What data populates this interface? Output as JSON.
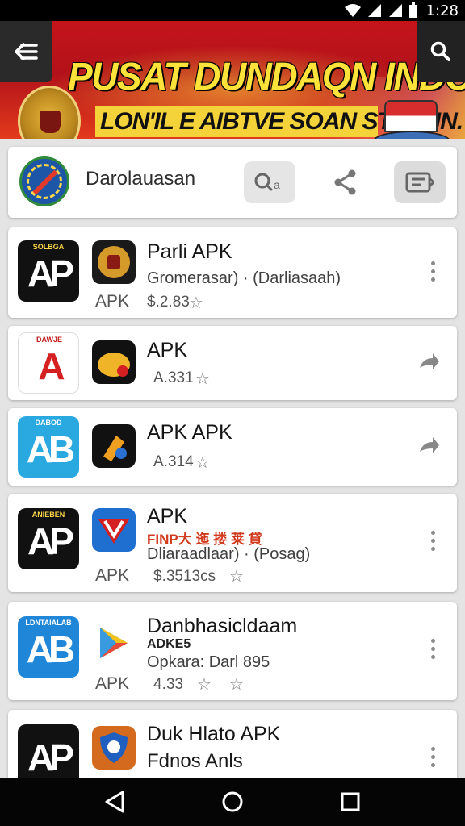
{
  "status_bar": {
    "time": "1:28"
  },
  "banner": {
    "title": "PUSAT DUNDAQN INDONESIA",
    "subtitle": "LON'IL E AIBTVE SOAN STERHN."
  },
  "header": {
    "name": "Darolauasan"
  },
  "apps": [
    {
      "title": "Parli APK",
      "subtitle": "Gromerasar) · (Darliasaah)",
      "apk_label": "APK",
      "rating": "$.2.83",
      "big_icon_text": "AP",
      "big_icon_tiny": "SOLBGA"
    },
    {
      "title": "APK",
      "rating": "A.331",
      "big_icon_text": "A",
      "big_icon_tiny": "DAWJE"
    },
    {
      "title": "APK APK",
      "rating": "A.314",
      "big_icon_text": "AB",
      "big_icon_tiny": "DABOD"
    },
    {
      "title": "APK",
      "subtitle_red": "FINP大 迤 搂 莱 貸",
      "subtitle": "Dliaraadlaar) · (Posag)",
      "apk_label": "APK",
      "rating": "$.3513cs",
      "big_icon_text": "AP",
      "big_icon_tiny": "ANIEBEN"
    },
    {
      "title": "Danbhasicldaam",
      "subtitle_small": "ADKE5",
      "subtitle": "Opkara: Darl 895",
      "apk_label": "APK",
      "rating": "4.33",
      "big_icon_text": "AB",
      "big_icon_tiny": "LDNTAIALAB"
    },
    {
      "title": "Duk Hlato APK",
      "subtitle": "Fdnos Anls",
      "big_icon_text": "AP"
    }
  ],
  "colors": {
    "banner_red": "#c4141a",
    "banner_yellow": "#ffe23a",
    "card_bg": "#ffffff",
    "page_bg": "#e4e4e4"
  },
  "icons": {
    "menu": "menu-back-icon",
    "search": "search-icon",
    "share": "share-icon",
    "list": "list-icon",
    "more": "more-vert-icon",
    "forward": "forward-icon",
    "star": "star-outline-icon",
    "nav_back": "triangle-back-icon",
    "nav_home": "circle-home-icon",
    "nav_recents": "square-recents-icon"
  }
}
